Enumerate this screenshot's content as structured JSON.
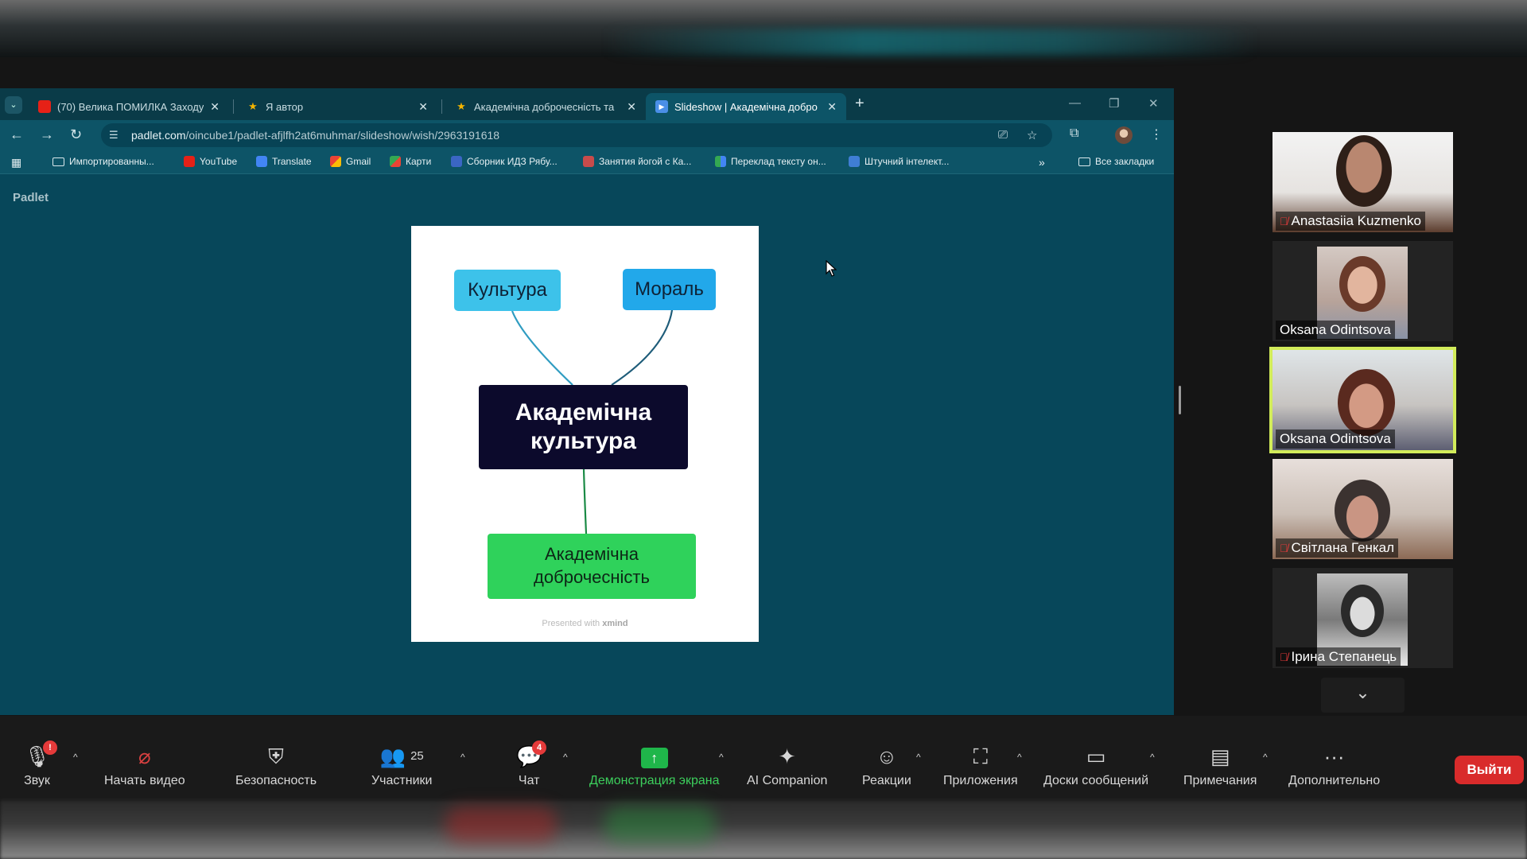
{
  "browser": {
    "tabs": [
      {
        "title": "(70) Велика ПОМИЛКА Заходу",
        "favicon": "youtube-icon",
        "active": false
      },
      {
        "title": "Я автор",
        "favicon": "yandex-icon",
        "active": false
      },
      {
        "title": "Академічна доброчесність та",
        "favicon": "padlet-icon",
        "active": false
      },
      {
        "title": "Slideshow | Академічна добро",
        "favicon": "slideshow-icon",
        "active": true
      }
    ],
    "url_host": "padlet.com",
    "url_path": "/oincube1/padlet-afjlfh2at6muhmar/slideshow/wish/2963191618",
    "bookmarks": [
      {
        "label": "Импортированны...",
        "icon": "folder-icon"
      },
      {
        "label": "YouTube",
        "icon": "youtube-icon"
      },
      {
        "label": "Translate",
        "icon": "translate-icon"
      },
      {
        "label": "Gmail",
        "icon": "gmail-icon"
      },
      {
        "label": "Карти",
        "icon": "maps-icon"
      },
      {
        "label": "Сборник ИДЗ Рябу...",
        "icon": "bookmark-icon"
      },
      {
        "label": "Занятия йогой с Ка...",
        "icon": "bookmark-icon"
      },
      {
        "label": "Переклад тексту он...",
        "icon": "translate-grid-icon"
      },
      {
        "label": "Штучний інтелект...",
        "icon": "ai-icon"
      }
    ],
    "all_bookmarks": "Все закладки",
    "overflow": "»"
  },
  "page": {
    "brand": "Padlet",
    "slide": {
      "node_culture": "Культура",
      "node_moral": "Мораль",
      "node_center_line1": "Академічна",
      "node_center_line2": "культура",
      "node_bottom_line1": "Академічна",
      "node_bottom_line2": "доброчесність",
      "footer_prefix": "Presented with",
      "footer_brand": "xmind"
    }
  },
  "participants": [
    {
      "name": "Anastasiia Kuzmenko",
      "muted": true,
      "speaking": false
    },
    {
      "name": "Oksana Odintsova",
      "muted": false,
      "speaking": false
    },
    {
      "name": "Oksana Odintsova",
      "muted": false,
      "speaking": true
    },
    {
      "name": "Світлана Генкал",
      "muted": true,
      "speaking": false
    },
    {
      "name": "Ірина Степанець",
      "muted": true,
      "speaking": false
    }
  ],
  "zoom_toolbar": {
    "audio": {
      "label": "Звук",
      "badge": "!"
    },
    "video": {
      "label": "Начать видео"
    },
    "security": {
      "label": "Безопасность"
    },
    "participants": {
      "label": "Участники",
      "count": "25"
    },
    "chat": {
      "label": "Чат",
      "badge": "4"
    },
    "share": {
      "label": "Демонстрация экрана"
    },
    "ai": {
      "label": "AI Companion"
    },
    "reactions": {
      "label": "Реакции"
    },
    "apps": {
      "label": "Приложения"
    },
    "whiteboards": {
      "label": "Доски сообщений"
    },
    "notes": {
      "label": "Примечания"
    },
    "more": {
      "label": "Дополнительно"
    },
    "leave": {
      "label": "Выйти"
    }
  },
  "colors": {
    "page_bg": "#07475a",
    "speaking_outline": "#d2ec5a",
    "share_green": "#1fb64a",
    "leave_red": "#d92b2b"
  }
}
